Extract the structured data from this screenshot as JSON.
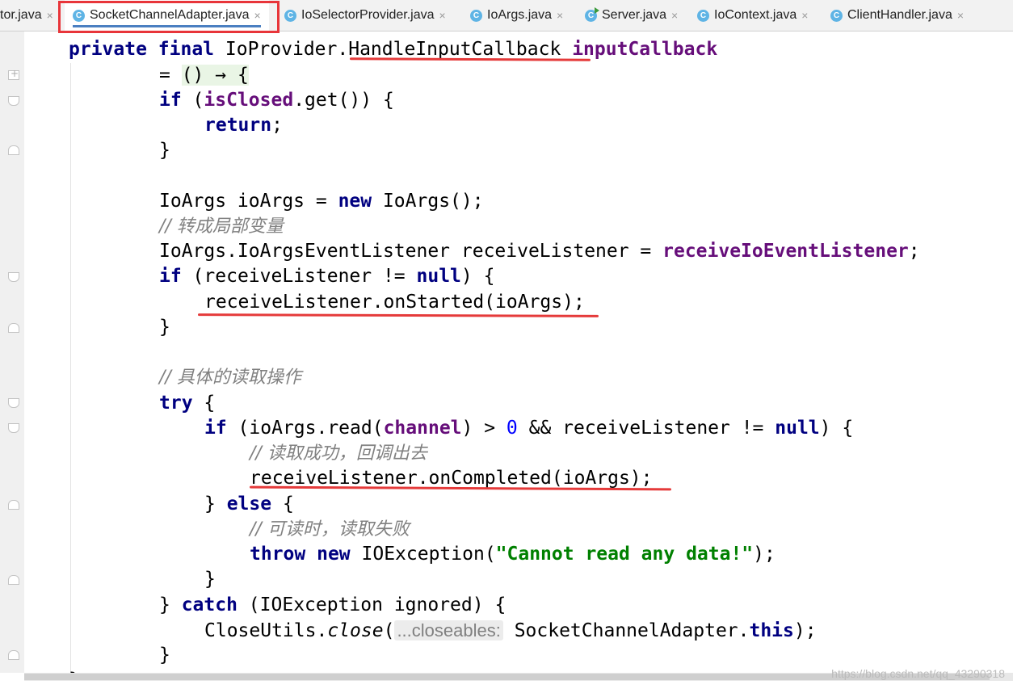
{
  "tabs": [
    {
      "label": "tor.java",
      "close": "×"
    },
    {
      "label": "SocketChannelAdapter.java",
      "close": "×",
      "active": true
    },
    {
      "label": "IoSelectorProvider.java",
      "close": "×"
    },
    {
      "label": "IoArgs.java",
      "close": "×"
    },
    {
      "label": "Server.java",
      "close": "×"
    },
    {
      "label": "IoContext.java",
      "close": "×"
    },
    {
      "label": "ClientHandler.java",
      "close": "×"
    }
  ],
  "tab_icon_letter": "C",
  "code": {
    "l1": {
      "private": "private",
      "final": "final",
      "type": " IoProvider.",
      "type2": "HandleInputCallback",
      "name": "inputCallback"
    },
    "l2": {
      "eq": "= ",
      "lambda": "() → {"
    },
    "l3": {
      "if": "if",
      "open": " (",
      "field": "isClosed",
      "rest": ".get()) {"
    },
    "l4": {
      "ret": "return",
      "semi": ";"
    },
    "l5": {
      "brace": "}"
    },
    "l6": {
      "a": "IoArgs ioArgs = ",
      "new": "new",
      "b": " IoArgs();"
    },
    "l7": {
      "comment": "// 转成局部变量"
    },
    "l8": {
      "a": "IoArgs.IoArgsEventListener receiveListener = ",
      "field": "receiveIoEventListener",
      "b": ";"
    },
    "l9": {
      "if": "if",
      "a": " (receiveListener != ",
      "null": "null",
      "b": ") {"
    },
    "l10": {
      "text": "receiveListener.onStarted(ioArgs);"
    },
    "l11": {
      "brace": "}"
    },
    "l12": {
      "comment": "// 具体的读取操作"
    },
    "l13": {
      "try": "try",
      "b": " {"
    },
    "l14": {
      "if": "if",
      "a": " (ioArgs.read(",
      "field": "channel",
      "b": ") > ",
      "num": "0",
      "c": " && receiveListener != ",
      "null": "null",
      "d": ") {"
    },
    "l15": {
      "comment": "// 读取成功，回调出去"
    },
    "l16": {
      "text": "receiveListener.onCompleted(ioArgs);"
    },
    "l17": {
      "a": "} ",
      "else": "else",
      "b": " {"
    },
    "l18": {
      "comment": "// 可读时，读取失败"
    },
    "l19": {
      "throw": "throw",
      "new": "new",
      "a": " IOException(",
      "str": "\"Cannot read any data!\"",
      "b": ");"
    },
    "l20": {
      "brace": "}"
    },
    "l21": {
      "a": "} ",
      "catch": "catch",
      "b": " (IOException ignored) {"
    },
    "l22": {
      "a": "CloseUtils.",
      "method": "close",
      "b": "(",
      "hint": "...closeables:",
      "c": " SocketChannelAdapter.",
      "this": "this",
      "d": ");"
    },
    "l23": {
      "brace": "}"
    },
    "l24": {
      "text": "};"
    }
  },
  "watermark": "https://blog.csdn.net/qq_43290318",
  "colors": {
    "keyword": "#000080",
    "field": "#660e7a",
    "comment": "#808080",
    "string": "#008000",
    "number": "#0000ff",
    "annotation": "#e8353a",
    "tab_icon": "#5fb4e5"
  }
}
